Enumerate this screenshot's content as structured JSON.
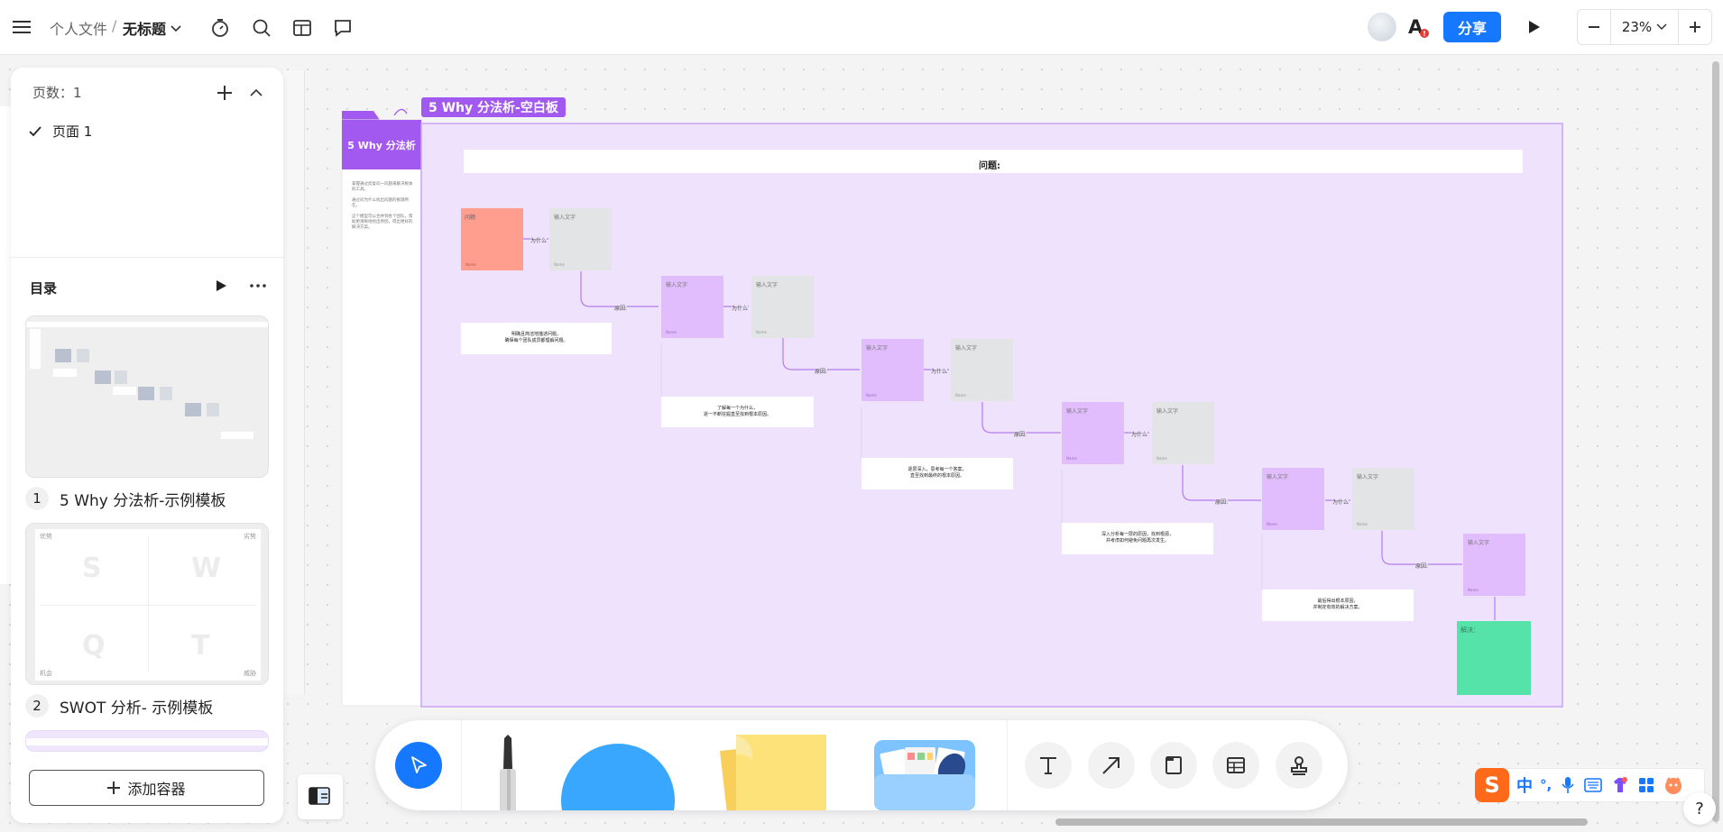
{
  "topbar": {
    "folder": "个人文件",
    "separator": "/",
    "title": "无标题",
    "share_label": "分享",
    "zoom": "23%"
  },
  "pages_panel": {
    "count_label": "页数：",
    "count": "1",
    "pages": [
      "页面 1"
    ]
  },
  "outline": {
    "title": "目录",
    "templates": [
      {
        "index": "1",
        "name": "5 Why 分法析-示例模板"
      },
      {
        "index": "2",
        "name": "SWOT 分析- 示例模板"
      }
    ],
    "swot_letters": [
      "S",
      "W",
      "Q",
      "T"
    ],
    "swot_corners": [
      "优势",
      "劣势",
      "机会",
      "威胁"
    ],
    "add_label": "添加容器"
  },
  "canvas": {
    "frame_title": "5 Why 分法析-空白板",
    "side_title": "5 Why 分法析",
    "side_paragraphs": [
      "掌握通过反复问一问题来解决根本的工具。",
      "通过问为什么找出问题的根源所在。",
      "这个模型可以合并到各个团队，帮助更清晰地找出原因，得出更好的解决方案。"
    ],
    "problem_label": "问题:",
    "problem_note": "问题",
    "input_label": "输入文字",
    "small_label": "Name",
    "why_label": "为什么",
    "because_label": "原因:",
    "solution_label": "解决：",
    "notes": [
      "明确且简洁地描述问题，\n确保每个团队成员都理解问题。",
      "了解每一个为什么，\n逐一不断挖掘直至找到根本原因。",
      "逐层深入，思考每一个答案，\n直至找到最终的根本原因。",
      "深入分析每一层的原因，找到根源，\n并考虑如何避免问题再次发生。",
      "最后得出根本原因，\n并制定有效的解决方案。"
    ]
  },
  "colors": {
    "accent": "#1677ff",
    "frame_purple": "#a259f0",
    "frame_bg": "#eee2fd",
    "problem_red": "#ff9d8f",
    "why_purple": "#e2bdfd",
    "gray_box": "#e3e4e5",
    "solution_green": "#56e3a9",
    "tool_blue": "#3aa7ff",
    "sticky_yellow": "#fde27a"
  },
  "icons": [
    "menu-icon",
    "timer-icon",
    "search-icon",
    "container-icon",
    "comment-icon",
    "font-icon",
    "play-icon",
    "minus-icon",
    "plus-icon",
    "chevron-down-icon",
    "chevron-up-icon",
    "check-icon",
    "more-icon",
    "pointer-icon",
    "text-icon",
    "arrow-icon",
    "frame-icon",
    "table-icon",
    "stamp-icon",
    "help-icon"
  ],
  "ime": {
    "lang": "中",
    "punct": "°,"
  },
  "help": "?"
}
